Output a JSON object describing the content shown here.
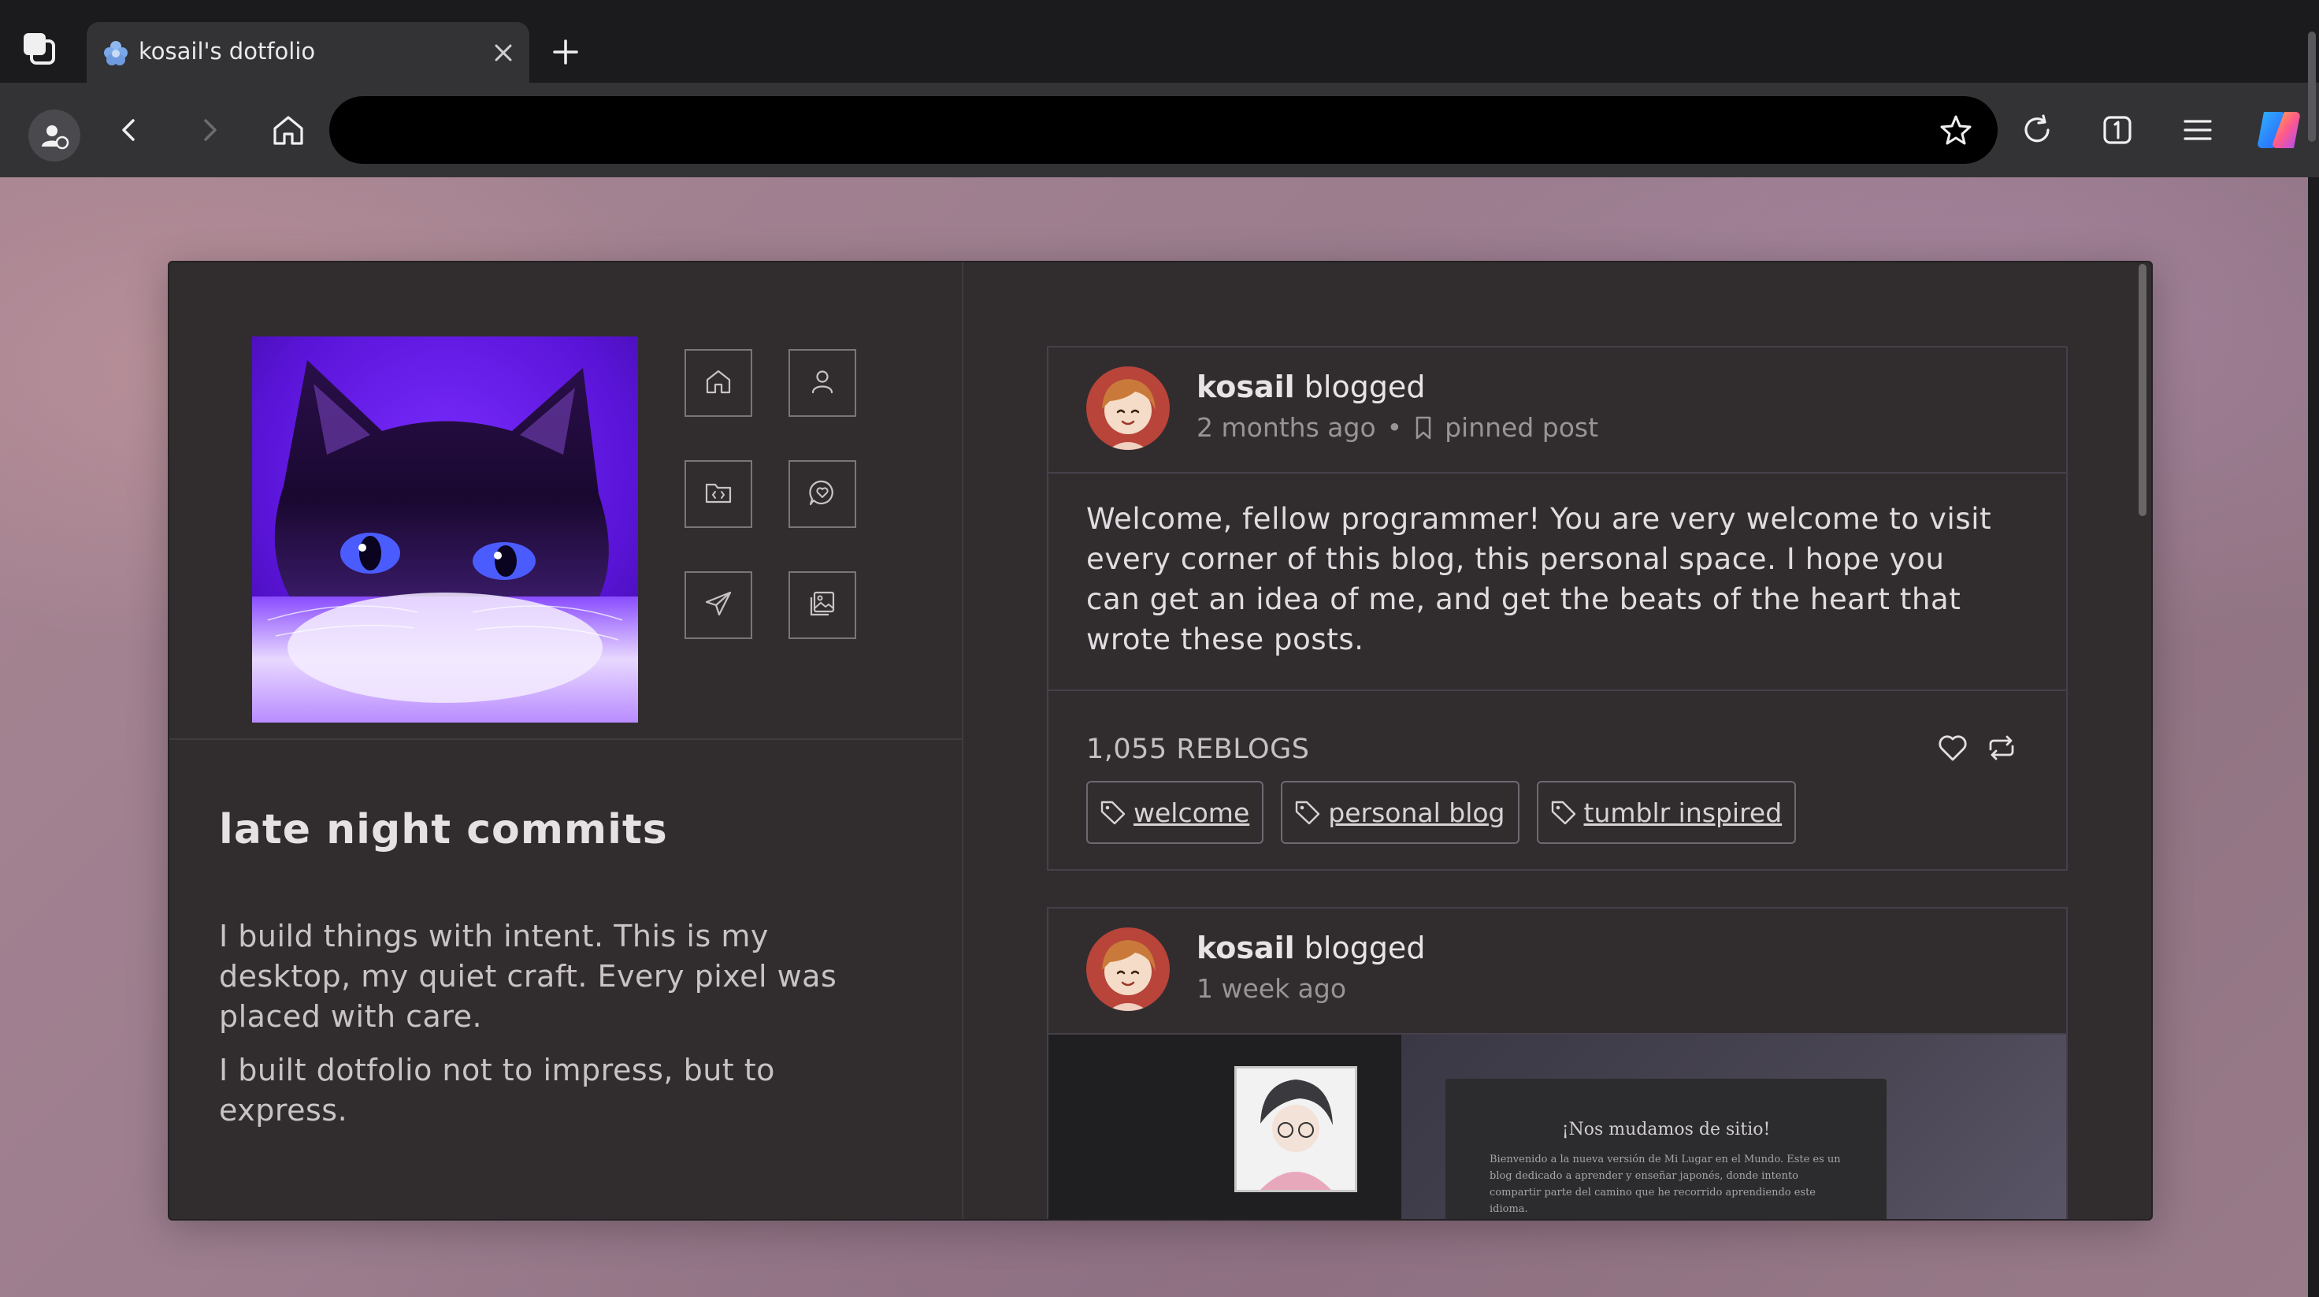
{
  "browser": {
    "tab_title": "kosail's dotfolio",
    "address_placeholder": "",
    "brand_colors": {
      "copilot_blue": "#3a8bff",
      "copilot_orange": "#ff8a3a",
      "copilot_purple": "#a64cff"
    }
  },
  "sidebar": {
    "nav_icons": [
      "home-icon",
      "user-icon",
      "code-folder-icon",
      "chat-heart-icon",
      "send-icon",
      "gallery-icon"
    ],
    "blog_title": "late night commits",
    "bio_paragraphs": [
      "I build things with intent. This is my desktop, my quiet craft. Every pixel was placed with care.",
      "I built dotfolio not to impress, but to express."
    ]
  },
  "posts": [
    {
      "author": "kosail",
      "action": "blogged",
      "time": "2 months ago",
      "separator": "•",
      "pinned_label": "pinned post",
      "body": "Welcome, fellow programmer! You are very welcome to visit every corner of this blog, this personal space. I hope you can get an idea of me, and get the beats of the heart that wrote these posts.",
      "reblogs": "1,055 REBLOGS",
      "tags": [
        "welcome",
        "personal blog",
        "tumblr inspired"
      ]
    },
    {
      "author": "kosail",
      "action": "blogged",
      "time": "1 week ago",
      "preview": {
        "heading": "¡Nos mudamos de sitio!",
        "text": "Bienvenido a la nueva versión de Mi Lugar en el Mundo. Este es un blog dedicado a aprender y enseñar japonés, donde intento compartir parte del camino que he recorrido aprendiendo este idioma."
      }
    }
  ]
}
